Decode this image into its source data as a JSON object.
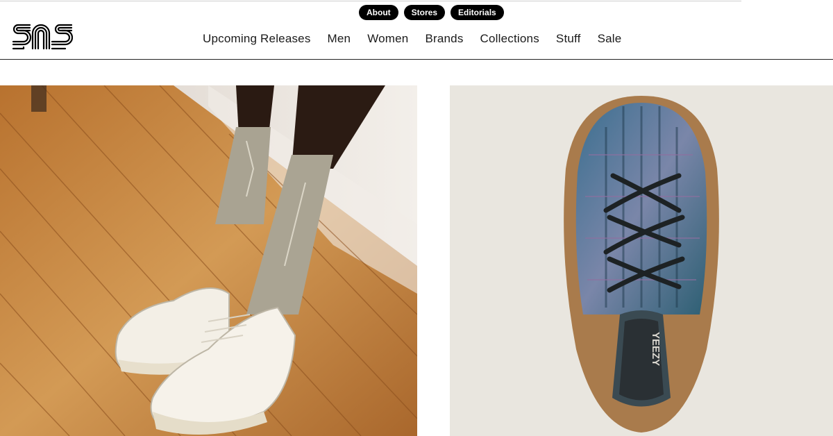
{
  "utility_nav": {
    "items": [
      {
        "label": "About"
      },
      {
        "label": "Stores"
      },
      {
        "label": "Editorials"
      }
    ]
  },
  "logo": {
    "alt": "sns",
    "icon": "sns-logo"
  },
  "main_nav": {
    "items": [
      {
        "label": "Upcoming Releases"
      },
      {
        "label": "Men"
      },
      {
        "label": "Women"
      },
      {
        "label": "Brands"
      },
      {
        "label": "Collections"
      },
      {
        "label": "Stuff"
      },
      {
        "label": "Sale"
      }
    ]
  },
  "hero": {
    "left_image": {
      "subject": "legs-wearing-white-sneakers-and-grey-socks-on-wood-floor"
    },
    "right_image": {
      "subject": "blue-knit-yeezy-sneaker-top-view",
      "printed_text": "YEEZY"
    }
  },
  "colors": {
    "pill_bg": "#000000",
    "pill_text": "#ffffff",
    "nav_text": "#1a1a1a",
    "rule": "#222222",
    "right_panel_bg": "#e9e6df",
    "floor": "#c9873f"
  }
}
